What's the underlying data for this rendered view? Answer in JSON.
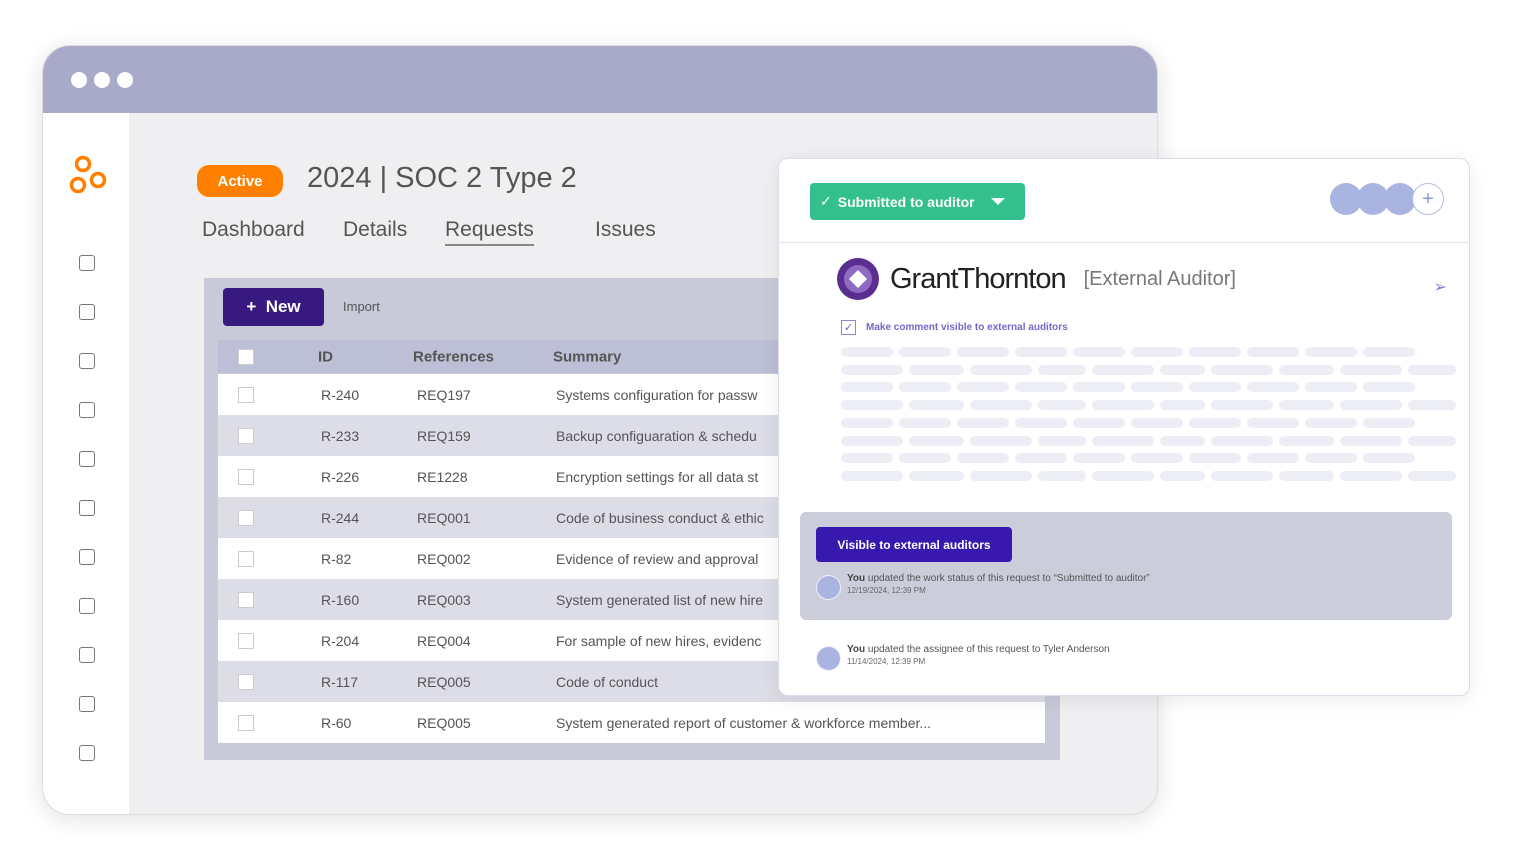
{
  "window": {
    "controls": [
      "close",
      "minimize",
      "maximize"
    ]
  },
  "sidebar": {
    "icons": [
      "dashboard-icon",
      "package-icon",
      "shield-icon",
      "workflow-icon",
      "bookmark-icon",
      "cloud-icon",
      "report-icon",
      "clipboard-icon",
      "integrations-icon",
      "flag-icon",
      "truck-icon"
    ]
  },
  "header": {
    "status": "Active",
    "title": "2024 | SOC 2 Type 2",
    "status_color": "#ff8000"
  },
  "tabs": [
    {
      "label": "Dashboard"
    },
    {
      "label": "Details"
    },
    {
      "label": "Requests",
      "active": true
    },
    {
      "label": "Issues"
    }
  ],
  "toolbar": {
    "new_label": "New",
    "import_label": "Import"
  },
  "table": {
    "columns": [
      "ID",
      "References",
      "Summary"
    ],
    "rows": [
      {
        "id": "R-240",
        "ref": "REQ197",
        "summary": "Systems configuration for passw"
      },
      {
        "id": "R-233",
        "ref": "REQ159",
        "summary": "Backup configuaration & schedu"
      },
      {
        "id": "R-226",
        "ref": "RE1228",
        "summary": "Encryption settings for all data st"
      },
      {
        "id": "R-244",
        "ref": "REQ001",
        "summary": "Code of business conduct & ethic"
      },
      {
        "id": "R-82",
        "ref": "REQ002",
        "summary": "Evidence of review and approval"
      },
      {
        "id": "R-160",
        "ref": "REQ003",
        "summary": "System generated list of new hire"
      },
      {
        "id": "R-204",
        "ref": "REQ004",
        "summary": "For sample of new hires, evidenc"
      },
      {
        "id": "R-117",
        "ref": "REQ005",
        "summary": "Code of conduct"
      },
      {
        "id": "R-60",
        "ref": "REQ005",
        "summary": "System generated report of customer & workforce member..."
      }
    ]
  },
  "panel": {
    "status_label": "Submitted to auditor",
    "status_color": "#33c08c",
    "auditor_name": "GrantThornton",
    "auditor_role": "[External Auditor]",
    "visibility_checkbox": "Make comment visible to external auditors",
    "visibility_checked": true,
    "visible_button": "Visible to external auditors",
    "activity": [
      {
        "who": "You",
        "text": " updated the work status of this request to “Submitted to auditor”",
        "time": "12/19/2024, 12:39 PM"
      },
      {
        "who": "You",
        "text": " updated the assignee of this request to Tyler Anderson",
        "time": "11/14/2024, 12:39 PM"
      }
    ]
  }
}
